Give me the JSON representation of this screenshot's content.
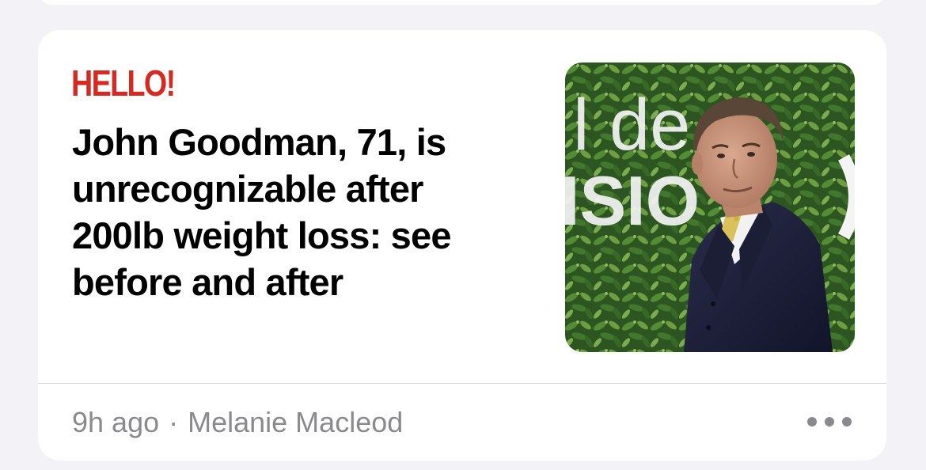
{
  "article": {
    "publisher": "HELLO!",
    "headline": "John Goodman, 71, is unrecognizable after 200lb weight loss: see before and after",
    "time_ago": "9h ago",
    "separator": "·",
    "author": "Melanie Macleod",
    "thumbnail_backdrop_text": "l de ISIO"
  },
  "colors": {
    "page_background": "#f2f2f7",
    "card_background": "#ffffff",
    "publisher_red": "#d42a22",
    "headline": "#000000",
    "meta_gray": "#8a8a8e"
  },
  "icons": {
    "more": "ellipsis-icon"
  }
}
